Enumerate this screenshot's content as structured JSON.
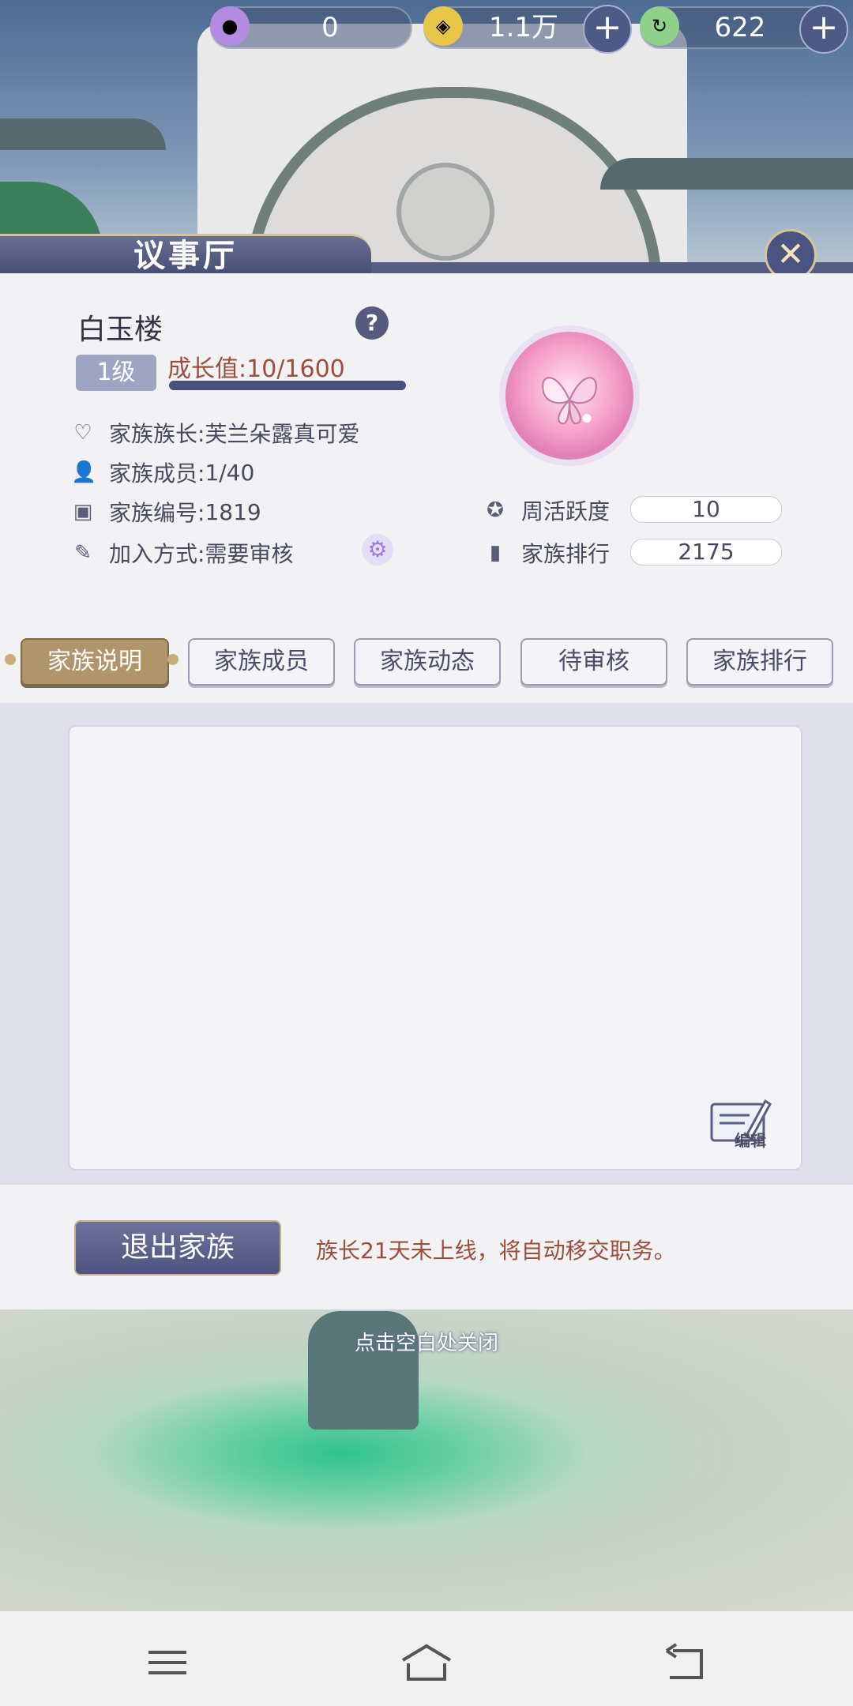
{
  "currencies": [
    {
      "icon": "purple-orb-icon",
      "value": "0",
      "has_plus": false
    },
    {
      "icon": "coin-icon",
      "value": "1.1万",
      "has_plus": true
    },
    {
      "icon": "green-jade-icon",
      "value": "622",
      "has_plus": true
    }
  ],
  "title": "议事厅",
  "family": {
    "name": "白玉楼",
    "level": "1级",
    "growth_label": "成长值:",
    "growth_value": "10/1600",
    "growth_progress": 0.00625,
    "leader_label": "家族族长:",
    "leader": "芙兰朵露真可爱",
    "members_label": "家族成员:",
    "members": "1/40",
    "id_label": "家族编号:",
    "id": "1819",
    "join_label": "加入方式:",
    "join": "需要审核"
  },
  "stats": {
    "weekly_label": "周活跃度",
    "weekly_value": "10",
    "rank_label": "家族排行",
    "rank_value": "2175"
  },
  "tabs": [
    {
      "label": "家族说明",
      "active": true
    },
    {
      "label": "家族成员",
      "active": false
    },
    {
      "label": "家族动态",
      "active": false
    },
    {
      "label": "待审核",
      "active": false
    },
    {
      "label": "家族排行",
      "active": false
    }
  ],
  "edit_label": "编辑",
  "exit_label": "退出家族",
  "notice": "族长21天未上线，将自动移交职务。",
  "close_hint": "点击空白处关闭",
  "colors": {
    "accent": "#4a4f7c",
    "tab_active": "#b0956a",
    "warning_text": "#9b4d3e"
  }
}
